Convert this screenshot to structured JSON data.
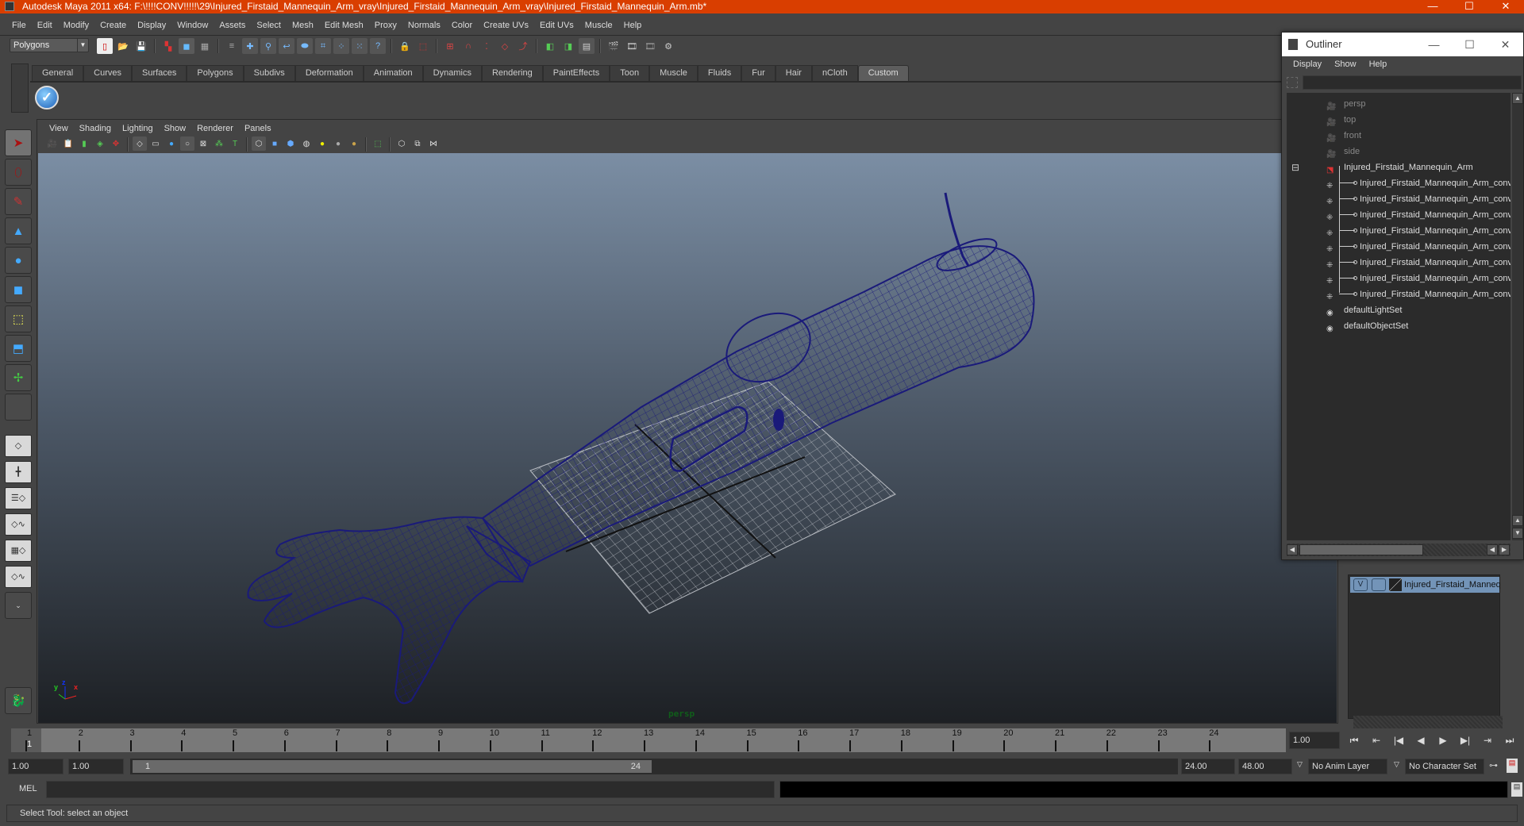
{
  "window": {
    "title": "Autodesk Maya 2011 x64: F:\\!!!!CONV!!!!!\\29\\Injured_Firstaid_Mannequin_Arm_vray\\Injured_Firstaid_Mannequin_Arm_vray\\Injured_Firstaid_Mannequin_Arm.mb*",
    "minimize": "—",
    "maximize": "☐",
    "close": "✕"
  },
  "menubar": [
    "File",
    "Edit",
    "Modify",
    "Create",
    "Display",
    "Window",
    "Assets",
    "Select",
    "Mesh",
    "Edit Mesh",
    "Proxy",
    "Normals",
    "Color",
    "Create UVs",
    "Edit UVs",
    "Muscle",
    "Help"
  ],
  "statusline": {
    "mode": "Polygons"
  },
  "shelf": {
    "tabs": [
      "General",
      "Curves",
      "Surfaces",
      "Polygons",
      "Subdivs",
      "Deformation",
      "Animation",
      "Dynamics",
      "Rendering",
      "PaintEffects",
      "Toon",
      "Muscle",
      "Fluids",
      "Fur",
      "Hair",
      "nCloth",
      "Custom"
    ],
    "active_tab": "Custom"
  },
  "panel": {
    "menu": [
      "View",
      "Shading",
      "Lighting",
      "Show",
      "Renderer",
      "Panels"
    ],
    "camera_label": "persp",
    "axes": {
      "x": "x",
      "y": "y",
      "z": "z"
    }
  },
  "outliner": {
    "title": "Outliner",
    "menu": [
      "Display",
      "Show",
      "Help"
    ],
    "filter_value": "",
    "items": [
      {
        "label": "persp",
        "type": "camera",
        "dim": true
      },
      {
        "label": "top",
        "type": "camera",
        "dim": true
      },
      {
        "label": "front",
        "type": "camera",
        "dim": true
      },
      {
        "label": "side",
        "type": "camera",
        "dim": true
      },
      {
        "label": "Injured_Firstaid_Mannequin_Arm",
        "type": "group",
        "expanded": true
      },
      {
        "label": "Injured_Firstaid_Mannequin_Arm_conve",
        "type": "mesh",
        "child": true
      },
      {
        "label": "Injured_Firstaid_Mannequin_Arm_conve",
        "type": "mesh",
        "child": true
      },
      {
        "label": "Injured_Firstaid_Mannequin_Arm_conve",
        "type": "mesh",
        "child": true
      },
      {
        "label": "Injured_Firstaid_Mannequin_Arm_conve",
        "type": "mesh",
        "child": true
      },
      {
        "label": "Injured_Firstaid_Mannequin_Arm_conve",
        "type": "mesh",
        "child": true
      },
      {
        "label": "Injured_Firstaid_Mannequin_Arm_conve",
        "type": "mesh",
        "child": true
      },
      {
        "label": "Injured_Firstaid_Mannequin_Arm_conve",
        "type": "mesh",
        "child": true
      },
      {
        "label": "Injured_Firstaid_Mannequin_Arm_conve",
        "type": "mesh",
        "child": true
      },
      {
        "label": "defaultLightSet",
        "type": "set"
      },
      {
        "label": "defaultObjectSet",
        "type": "set"
      }
    ]
  },
  "layers": {
    "rows": [
      {
        "visible": "V",
        "name": "Injured_Firstaid_Manneq"
      }
    ]
  },
  "timeline": {
    "ticks": [
      "1",
      "2",
      "3",
      "4",
      "5",
      "6",
      "7",
      "8",
      "9",
      "10",
      "11",
      "12",
      "13",
      "14",
      "15",
      "16",
      "17",
      "18",
      "19",
      "20",
      "21",
      "22",
      "23",
      "24"
    ],
    "current_marker": "1",
    "current_time": "1.00"
  },
  "range": {
    "start_time": "1.00",
    "playback_start": "1.00",
    "slider_start": "1",
    "slider_end": "24",
    "playback_end": "24.00",
    "end_time": "48.00",
    "anim_layer": "No Anim Layer",
    "character_set": "No Character Set"
  },
  "playback": {
    "buttons": [
      "⏮",
      "⇤",
      "|◀",
      "◀",
      "▶",
      "▶|",
      "⇥",
      "⏭"
    ]
  },
  "command": {
    "label": "MEL",
    "value": ""
  },
  "help_line": "Select Tool: select an object"
}
